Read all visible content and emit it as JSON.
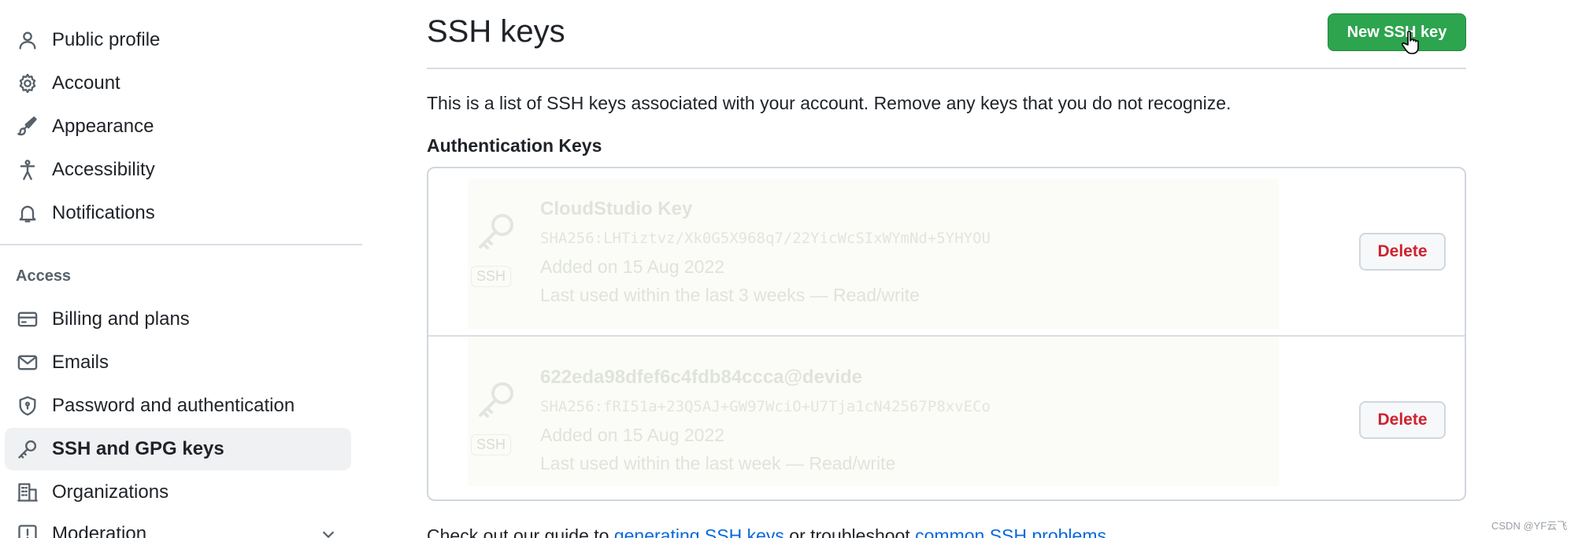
{
  "sidebar": {
    "items": [
      {
        "label": "Public profile",
        "icon": "person-icon"
      },
      {
        "label": "Account",
        "icon": "gear-icon"
      },
      {
        "label": "Appearance",
        "icon": "paintbrush-icon"
      },
      {
        "label": "Accessibility",
        "icon": "accessibility-icon"
      },
      {
        "label": "Notifications",
        "icon": "bell-icon"
      }
    ],
    "section_label": "Access",
    "access_items": [
      {
        "label": "Billing and plans",
        "icon": "credit-card-icon"
      },
      {
        "label": "Emails",
        "icon": "mail-icon"
      },
      {
        "label": "Password and authentication",
        "icon": "shield-icon"
      },
      {
        "label": "SSH and GPG keys",
        "icon": "key-icon",
        "active": true
      },
      {
        "label": "Organizations",
        "icon": "organization-icon"
      },
      {
        "label": "Moderation",
        "icon": "report-icon"
      }
    ]
  },
  "main": {
    "title": "SSH keys",
    "new_button_label": "New SSH key",
    "intro": "This is a list of SSH keys associated with your account. Remove any keys that you do not recognize.",
    "subhead": "Authentication Keys",
    "keys": [
      {
        "name": "CloudStudio Key",
        "fingerprint": "SHA256:LHTiztvz/Xk0G5X968q7/22YicWcSIxWYmNd+5YHYOU",
        "added": "Added on 15 Aug 2022",
        "last_used": "Last used within the last 3 weeks — Read/write",
        "badge": "SSH",
        "delete_label": "Delete"
      },
      {
        "name": "622eda98dfef6c4fdb84ccca@devide",
        "fingerprint": "SHA256:fRI51a+23Q5AJ+GW97WciO+U7Tja1cN42567P8xvECo",
        "added": "Added on 15 Aug 2022",
        "last_used": "Last used within the last week — Read/write",
        "badge": "SSH",
        "delete_label": "Delete"
      }
    ],
    "footer": {
      "prefix": "Check out our guide to ",
      "link1": "generating SSH keys",
      "middle": " or troubleshoot ",
      "link2": "common SSH problems",
      "suffix": "."
    }
  },
  "watermark": "CSDN @YF云飞",
  "colors": {
    "primary_button": "#2da44e",
    "danger": "#cf222e",
    "link": "#0969da",
    "active_bg": "#eff1f3"
  }
}
